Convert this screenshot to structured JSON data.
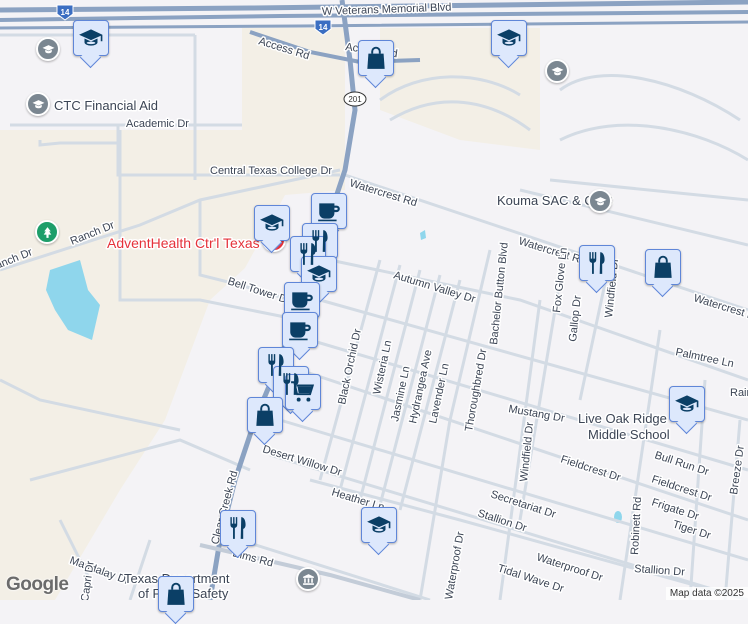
{
  "map": {
    "colors": {
      "highway": "#8ba2c2",
      "road": "#d3dbe4",
      "land": "#f4f3f6",
      "campus": "#f3efe6",
      "water": "#8fd6ec",
      "pin_fill": "#dde8fc",
      "pin_border": "#5f86d8",
      "icon": "#0b3f66",
      "hospital": "#e5323a",
      "park": "#1e9e6a"
    },
    "shields": [
      "14",
      "14",
      "201"
    ],
    "streets": [
      "W Veterans Memorial Blvd",
      "Access Rd",
      "Access Rd",
      "Academic Dr",
      "CTC Financial Aid",
      "Central Texas College Dr",
      "Ranch Dr",
      "Ranch Dr",
      "AdventHealth Ctr'l Texas",
      "Bell Tower Dr",
      "Watercrest Rd",
      "Watercrest Rd",
      "Watercrest Rd",
      "Kouma SAC & CDC",
      "Autumn Valley Dr",
      "Bachelor Button Blvd",
      "Fox Glove Ln",
      "Gallop Dr",
      "Windfield Dr",
      "Palmtree Ln",
      "Black Orchid Dr",
      "Wisteria Ln",
      "Jasmine Ln",
      "Hydrangea Ave",
      "Lavender Ln",
      "Thoroughbred Dr",
      "Mustang Dr",
      "Windfield Dr",
      "Live Oak Ridge",
      "Middle School",
      "Fieldcrest Dr",
      "Bull Run Dr",
      "Fieldcrest Dr",
      "Frigate Dr",
      "Tiger Dr",
      "Breeze Dr",
      "Robinett Rd",
      "Desert Willow Dr",
      "Heather Ln",
      "Secretariat Dr",
      "Stallion Dr",
      "Stallion Dr",
      "Waterproof Dr",
      "Waterproof Dr",
      "Tidal Wave Dr",
      "Clear Creek Rd",
      "Mandalay Dr",
      "Capri Dr",
      "Texas Department",
      "of Public Safety",
      "Elms Rd",
      "Rain"
    ],
    "markers": [
      {
        "type": "school",
        "icon": "graduation-cap-icon"
      },
      {
        "type": "shopping",
        "icon": "shopping-bag-icon"
      },
      {
        "type": "school",
        "icon": "graduation-cap-icon"
      },
      {
        "type": "school",
        "icon": "graduation-cap-icon"
      },
      {
        "type": "cafe",
        "icon": "coffee-cup-icon"
      },
      {
        "type": "restaurant",
        "icon": "fork-knife-icon"
      },
      {
        "type": "restaurant",
        "icon": "fork-knife-icon"
      },
      {
        "type": "school",
        "icon": "graduation-cap-icon"
      },
      {
        "type": "cafe",
        "icon": "coffee-cup-icon"
      },
      {
        "type": "cafe",
        "icon": "coffee-cup-icon"
      },
      {
        "type": "restaurant",
        "icon": "fork-knife-icon"
      },
      {
        "type": "restaurant",
        "icon": "fork-knife-icon"
      },
      {
        "type": "grocery",
        "icon": "shopping-cart-icon"
      },
      {
        "type": "shopping",
        "icon": "shopping-bag-icon"
      },
      {
        "type": "restaurant",
        "icon": "fork-knife-icon"
      },
      {
        "type": "shopping",
        "icon": "shopping-bag-icon"
      },
      {
        "type": "school",
        "icon": "graduation-cap-icon"
      },
      {
        "type": "school",
        "icon": "graduation-cap-icon"
      },
      {
        "type": "restaurant",
        "icon": "fork-knife-icon"
      },
      {
        "type": "shopping",
        "icon": "shopping-bag-icon"
      }
    ],
    "attribution": "Map data ©2025",
    "logo": "Google"
  }
}
